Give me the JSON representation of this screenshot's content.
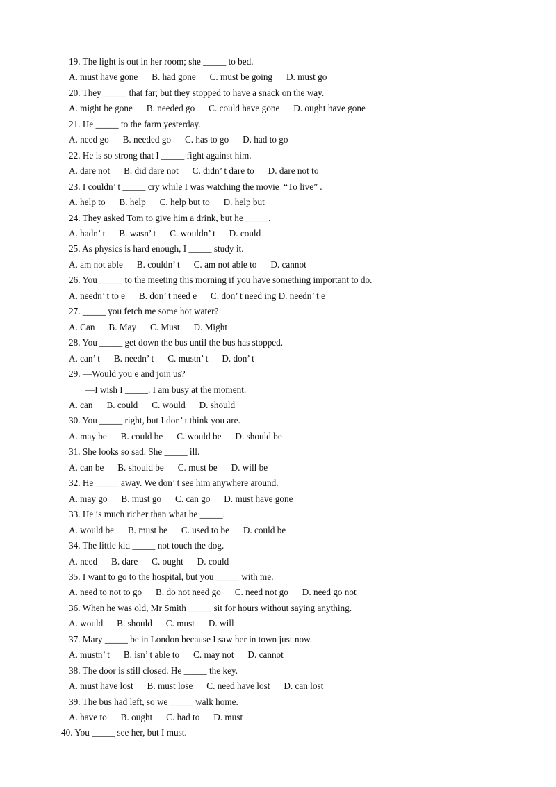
{
  "document": {
    "type": "grammar-worksheet",
    "page_background": "#ffffff",
    "text_color": "#111111",
    "blank_placeholder": "_____",
    "lines": [
      {
        "kind": "stem",
        "id": "q19-stem",
        "text": "19. The light is out in her room; she _____ to bed."
      },
      {
        "kind": "options",
        "id": "q19-options",
        "text": "A. must have gone      B. had gone      C. must be going      D. must go"
      },
      {
        "kind": "stem",
        "id": "q20-stem",
        "text": "20. They _____ that far; but they stopped to have a snack on the way."
      },
      {
        "kind": "options",
        "id": "q20-options",
        "text": "A. might be gone      B. needed go      C. could have gone      D. ought have gone"
      },
      {
        "kind": "stem",
        "id": "q21-stem",
        "text": "21. He _____ to the farm yesterday."
      },
      {
        "kind": "options",
        "id": "q21-options",
        "text": "A. need go      B. needed go      C. has to go      D. had to go"
      },
      {
        "kind": "stem",
        "id": "q22-stem",
        "text": "22. He is so strong that I _____ fight against him."
      },
      {
        "kind": "options",
        "id": "q22-options",
        "text": "A. dare not      B. did dare not      C. didn’ t dare to      D. dare not to"
      },
      {
        "kind": "stem",
        "id": "q23-stem",
        "text": "23. I couldn’ t _____ cry while I was watching the movie  “To live” ."
      },
      {
        "kind": "options",
        "id": "q23-options",
        "text": "A. help to      B. help      C. help but to      D. help but"
      },
      {
        "kind": "stem",
        "id": "q24-stem",
        "text": "24. They asked Tom to give him a drink, but he _____."
      },
      {
        "kind": "options",
        "id": "q24-options",
        "text": "A. hadn’ t      B. wasn’ t      C. wouldn’ t      D. could"
      },
      {
        "kind": "stem",
        "id": "q25-stem",
        "text": "25. As physics is hard enough, I _____ study it."
      },
      {
        "kind": "options",
        "id": "q25-options",
        "text": "A. am not able      B. couldn’ t      C. am not able to      D. cannot"
      },
      {
        "kind": "stem",
        "id": "q26-stem",
        "text": "26. You _____ to the meeting this morning if you have something important to do."
      },
      {
        "kind": "options",
        "id": "q26-options",
        "text": "A. needn’ t to e      B. don’ t need e      C. don’ t need ing D. needn’ t e"
      },
      {
        "kind": "stem",
        "id": "q27-stem",
        "text": "27. _____ you fetch me some hot water?"
      },
      {
        "kind": "options",
        "id": "q27-options",
        "text": "A. Can      B. May      C. Must      D. Might"
      },
      {
        "kind": "stem",
        "id": "q28-stem",
        "text": "28. You _____ get down the bus until the bus has stopped."
      },
      {
        "kind": "options",
        "id": "q28-options",
        "text": "A. can’ t      B. needn’ t      C. mustn’ t      D. don’ t"
      },
      {
        "kind": "stem",
        "id": "q29-stem",
        "text": "29. —Would you e and join us?"
      },
      {
        "kind": "cont",
        "id": "q29-reply",
        "text": "—I wish I _____. I am busy at the moment."
      },
      {
        "kind": "options",
        "id": "q29-options",
        "text": "A. can      B. could      C. would      D. should"
      },
      {
        "kind": "stem",
        "id": "q30-stem",
        "text": "30. You _____ right, but I don’ t think you are."
      },
      {
        "kind": "options",
        "id": "q30-options",
        "text": "A. may be      B. could be      C. would be      D. should be"
      },
      {
        "kind": "stem",
        "id": "q31-stem",
        "text": "31. She looks so sad. She _____ ill."
      },
      {
        "kind": "options",
        "id": "q31-options",
        "text": "A. can be      B. should be      C. must be      D. will be"
      },
      {
        "kind": "stem",
        "id": "q32-stem",
        "text": "32. He _____ away. We don’ t see him anywhere around."
      },
      {
        "kind": "options",
        "id": "q32-options",
        "text": "A. may go      B. must go      C. can go      D. must have gone"
      },
      {
        "kind": "stem",
        "id": "q33-stem",
        "text": "33. He is much richer than what he _____."
      },
      {
        "kind": "options",
        "id": "q33-options",
        "text": "A. would be      B. must be      C. used to be      D. could be"
      },
      {
        "kind": "stem",
        "id": "q34-stem",
        "text": "34. The little kid _____ not touch the dog."
      },
      {
        "kind": "options",
        "id": "q34-options",
        "text": "A. need      B. dare      C. ought      D. could"
      },
      {
        "kind": "stem",
        "id": "q35-stem",
        "text": "35. I want to go to the hospital, but you _____ with me."
      },
      {
        "kind": "options",
        "id": "q35-options",
        "text": "A. need to not to go      B. do not need go      C. need not go      D. need go not"
      },
      {
        "kind": "stem",
        "id": "q36-stem",
        "text": "36. When he was old, Mr Smith _____ sit for hours without saying anything."
      },
      {
        "kind": "options",
        "id": "q36-options",
        "text": "A. would      B. should      C. must      D. will"
      },
      {
        "kind": "stem",
        "id": "q37-stem",
        "text": "37. Mary _____ be in London because I saw her in town just now."
      },
      {
        "kind": "options",
        "id": "q37-options",
        "text": "A. mustn’ t      B. isn’ t able to      C. may not      D. cannot"
      },
      {
        "kind": "stem",
        "id": "q38-stem",
        "text": "38. The door is still closed. He _____ the key."
      },
      {
        "kind": "options",
        "id": "q38-options",
        "text": "A. must have lost      B. must lose      C. need have lost      D. can lost"
      },
      {
        "kind": "stem",
        "id": "q39-stem",
        "text": "39. The bus had left, so we _____ walk home."
      },
      {
        "kind": "options",
        "id": "q39-options",
        "text": "A. have to      B. ought      C. had to      D. must"
      },
      {
        "kind": "outdent",
        "id": "q40-stem",
        "text": "40. You _____ see her, but I must."
      }
    ]
  }
}
